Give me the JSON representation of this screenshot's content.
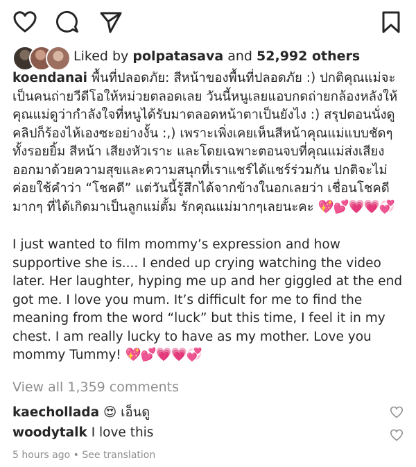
{
  "actions": {
    "like_icon": "heart-outline",
    "comment_icon": "speech-bubble",
    "share_icon": "paper-plane",
    "save_icon": "bookmark-outline"
  },
  "likes": {
    "prefix": "Liked by",
    "user": "polpatasava",
    "and": "and",
    "count": "52,992 others"
  },
  "caption": {
    "username": "koendanai",
    "thai": "พื้นที่ปลอดภัย: สีหน้าของพื้นที่ปลอดภัย :) ปกติคุณแม่จะเป็นคนถ่ายวีดีโอให้หม่วยตลอดเลย วันนี้หนูเลยแอบกดถ่ายกล้องหลังให้คุณแม่ดูว่ากำลังใจที่หนูได้รับมาตลอดหน้าตาเป็นยังไง :) สรุปตอนนั่งดูคลิปก็ร้องไห้เองซะอย่างงั้น :,) เพราะเพิ่งเคยเห็นสีหน้าคุณแม่แบบชัดๆ ทั้งรอยยิ้ม สีหน้า เสียงหัวเราะ และโดยเฉพาะตอนจบที่คุณแม่ส่งเสียงออกมาด้วยความสุขและความสนุกที่เราแชร์ได้แชร์ร่วมกัน ปกติจะไม่ค่อยใช้คำว่า “โชคดี” แต่วันนี้รู้สึกได้จากข้างในอกเลยว่า เชื่อนโชคดีมากๆ ที่ได้เกิดมาเป็นลูกแม่ตั้ม รักคุณแม่มากๆเลยนะคะ",
    "thai_emoji": "💖💕💗💗💞",
    "english": "I just wanted to film mommy’s expression and how supportive she is.... I ended up crying watching the video later. Her laughter, hyping me up and her giggled at the end got me. I love you mum. It’s difficult for me to find the meaning from the word “luck” but this time, I feel it in my chest. I am really lucky to have as my mother. Love you mommy Tummy!",
    "english_emoji": "💖💕💗💗💞"
  },
  "view_all": "View all 1,359 comments",
  "comments": [
    {
      "user": "kaechollada",
      "text": "😍 เอ็นดู"
    },
    {
      "user": "woodytalk",
      "text": "I love this"
    }
  ],
  "footer": {
    "time": "5 hours ago",
    "sep": " • ",
    "translate": "See translation"
  }
}
